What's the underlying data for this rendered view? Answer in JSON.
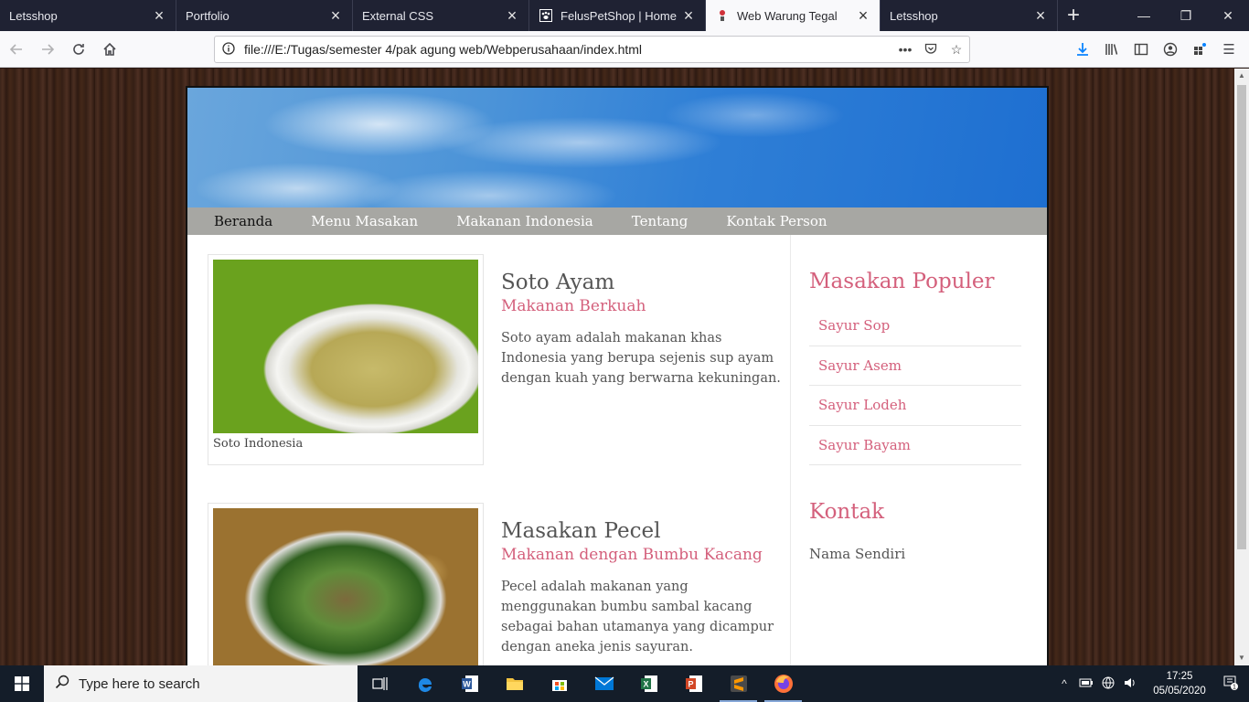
{
  "browser": {
    "tabs": [
      {
        "title": "Letsshop",
        "active": false
      },
      {
        "title": "Portfolio",
        "active": false
      },
      {
        "title": "External CSS",
        "active": false
      },
      {
        "title": "FelusPetShop | Home",
        "active": false
      },
      {
        "title": "Web Warung Tegal",
        "active": true
      },
      {
        "title": "Letsshop",
        "active": false
      }
    ],
    "url": "file:///E:/Tugas/semester 4/pak agung web/Webperusahaan/index.html"
  },
  "site": {
    "menu": [
      "Beranda",
      "Menu Masakan",
      "Makanan Indonesia",
      "Tentang",
      "Kontak Person"
    ],
    "articles": [
      {
        "caption": "Soto Indonesia",
        "title": "Soto Ayam",
        "subtitle": "Makanan Berkuah",
        "body": "Soto ayam adalah makanan khas Indonesia yang berupa sejenis sup ayam dengan kuah yang berwarna kekuningan."
      },
      {
        "caption": "",
        "title": "Masakan Pecel",
        "subtitle": "Makanan dengan Bumbu Kacang",
        "body": "Pecel adalah makanan yang menggunakan bumbu sambal kacang sebagai bahan utamanya yang dicampur dengan aneka jenis sayuran."
      }
    ],
    "sidebar": {
      "popular_heading": "Masakan Populer",
      "popular_items": [
        "Sayur Sop",
        "Sayur Asem",
        "Sayur Lodeh",
        "Sayur Bayam"
      ],
      "contact_heading": "Kontak",
      "contact_text": "Nama Sendiri"
    },
    "colors": {
      "accent": "#d4607c",
      "menu_bg": "#a7a7a3",
      "banner": "#2f7fd6"
    }
  },
  "taskbar": {
    "search_placeholder": "Type here to search",
    "time": "17:25",
    "date": "05/05/2020",
    "notification_count": "1"
  }
}
